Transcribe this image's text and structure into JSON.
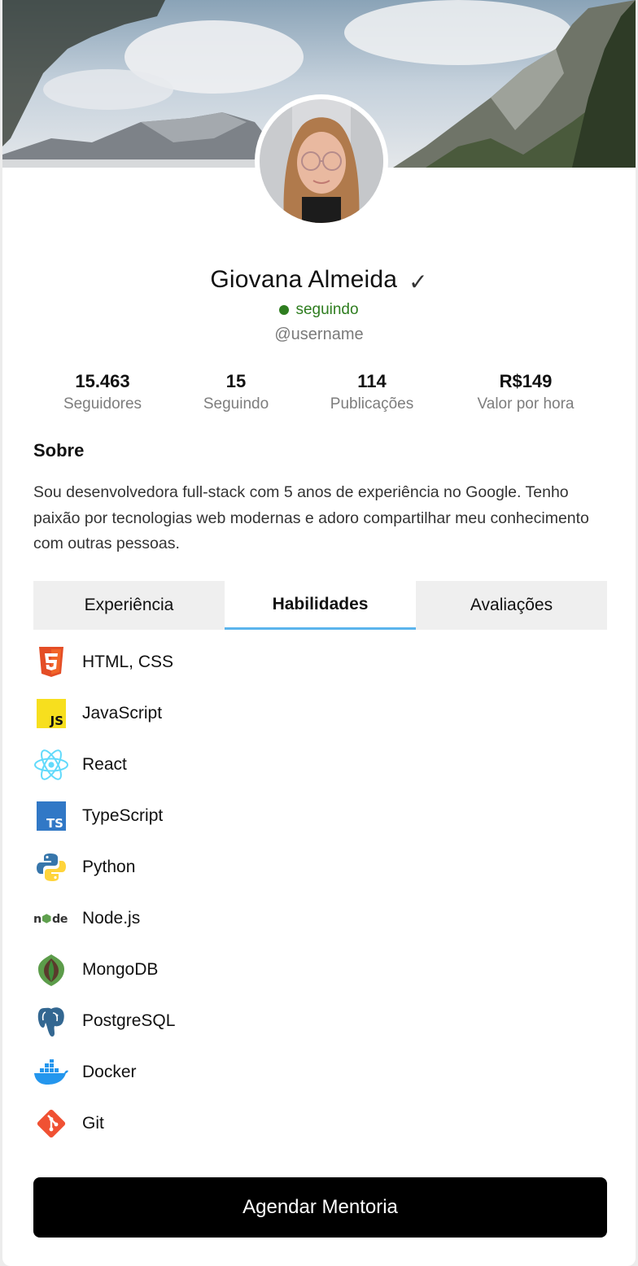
{
  "profile": {
    "name": "Giovana Almeida",
    "verified_mark": "✓",
    "status": "seguindo",
    "username": "@username"
  },
  "stats": [
    {
      "value": "15.463",
      "label": "Seguidores"
    },
    {
      "value": "15",
      "label": "Seguindo"
    },
    {
      "value": "114",
      "label": "Publicações"
    },
    {
      "value": "R$149",
      "label": "Valor por hora"
    }
  ],
  "about": {
    "title": "Sobre",
    "text": "Sou desenvolvedora full-stack com 5 anos de experiência no Google. Tenho paixão por tecnologias web modernas e adoro compartilhar meu conhecimento com outras pessoas."
  },
  "tabs": [
    {
      "label": "Experiência",
      "active": false
    },
    {
      "label": "Habilidades",
      "active": true
    },
    {
      "label": "Avaliações",
      "active": false
    }
  ],
  "skills": [
    {
      "name": "HTML, CSS",
      "icon": "html5-icon"
    },
    {
      "name": "JavaScript",
      "icon": "javascript-icon"
    },
    {
      "name": "React",
      "icon": "react-icon"
    },
    {
      "name": "TypeScript",
      "icon": "typescript-icon"
    },
    {
      "name": "Python",
      "icon": "python-icon"
    },
    {
      "name": "Node.js",
      "icon": "nodejs-icon"
    },
    {
      "name": "MongoDB",
      "icon": "mongodb-icon"
    },
    {
      "name": "PostgreSQL",
      "icon": "postgresql-icon"
    },
    {
      "name": "Docker",
      "icon": "docker-icon"
    },
    {
      "name": "Git",
      "icon": "git-icon"
    }
  ],
  "cta": {
    "label": "Agendar Mentoria"
  },
  "colors": {
    "status_green": "#2e7d1f",
    "tab_active_underline": "#5bb4ec",
    "cta_background": "#000000"
  }
}
